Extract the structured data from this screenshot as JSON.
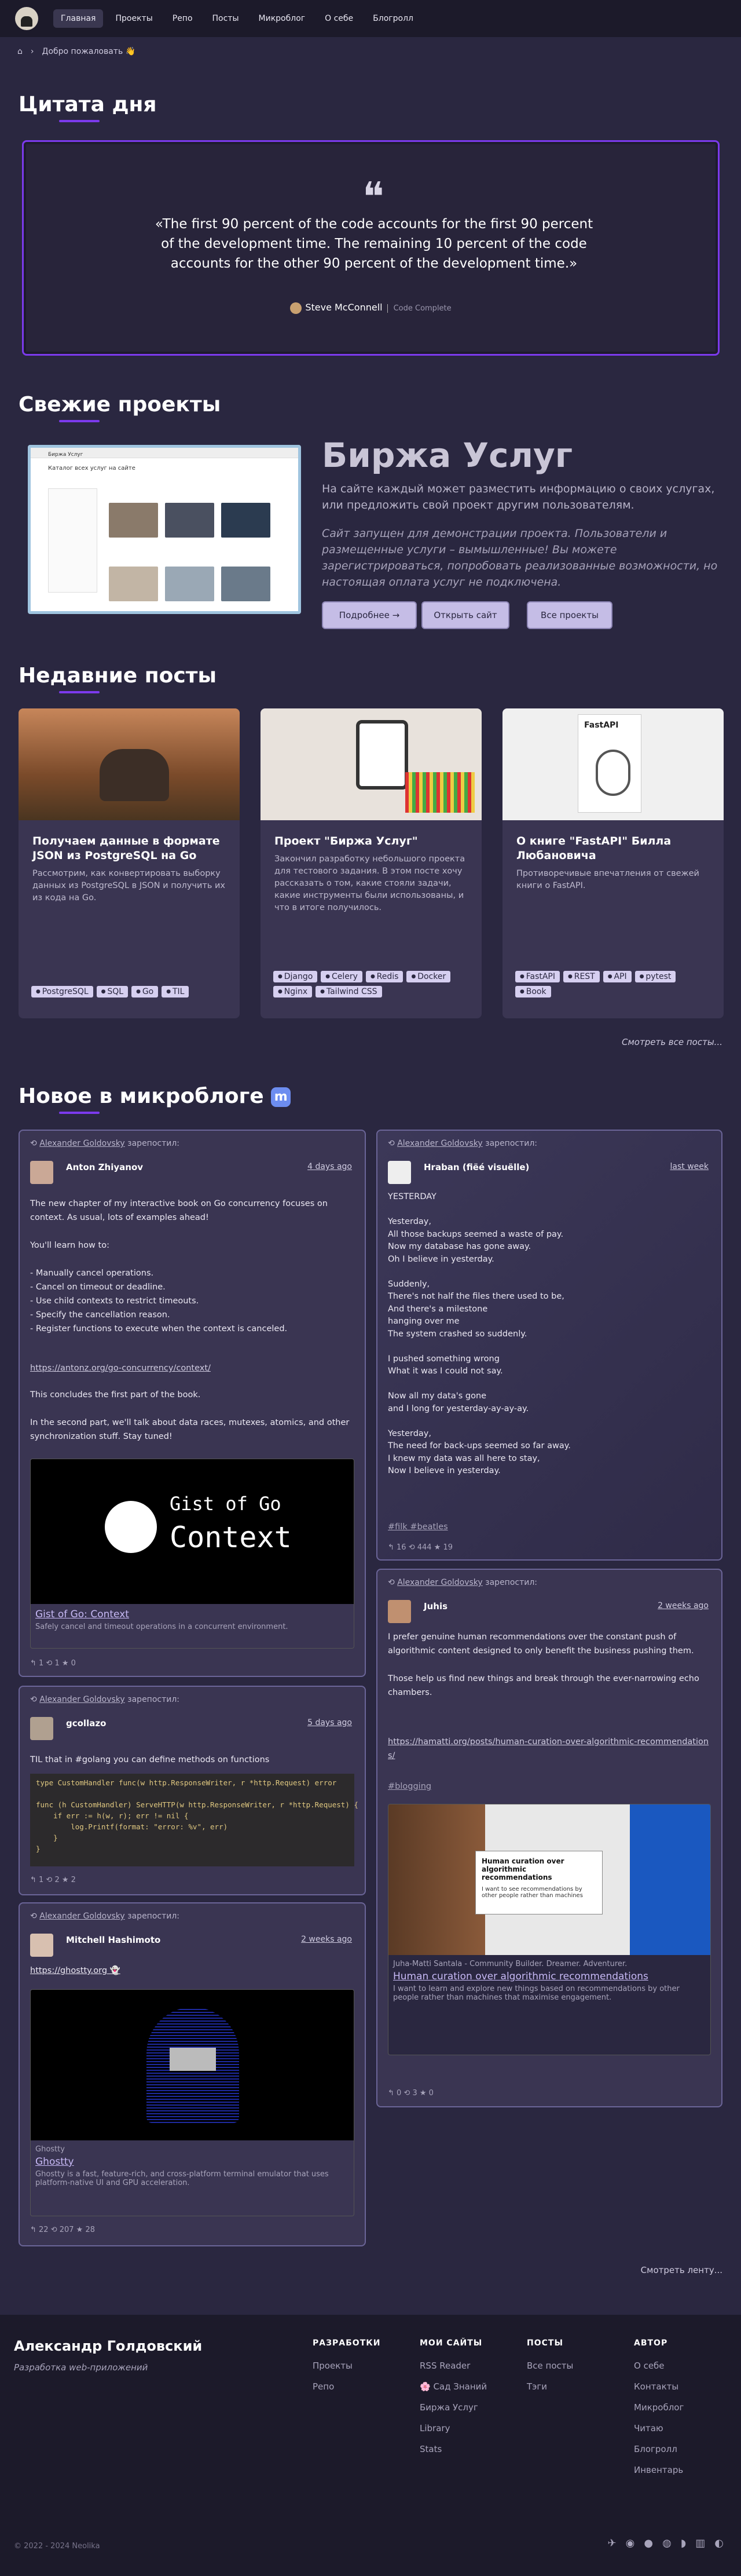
{
  "nav": {
    "items": [
      "Главная",
      "Проекты",
      "Репо",
      "Посты",
      "Микроблог",
      "О себе",
      "Блогролл"
    ]
  },
  "breadcrumb": {
    "welcome": "Добро пожаловать 👋"
  },
  "quote_section": {
    "title": "Цитата дня",
    "text": "«The first 90 percent of the code accounts for the first 90 percent of the development time. The remaining 10 percent of the code accounts for the other 90 percent of the development time.»",
    "author": "Steve McConnell",
    "source": "Code Complete"
  },
  "projects_section": {
    "title": "Свежие проекты",
    "project_title": "Биржа Услуг",
    "description": "На сайте каждый может разместить информацию о своих услугах, или предложить свой проект другим пользователям.",
    "note": "Сайт запущен для демонстрации проекта. Пользователи и размещенные услуги – вымышленные! Вы можете зарегистрироваться, попробовать реализованные возможности, но настоящая оплата услуг не подключена.",
    "btn_more": "Подробнее →",
    "btn_open": "Открыть сайт",
    "btn_all": "Все проекты",
    "screenshot_heading": "Биржа Услуг",
    "screenshot_sub": "Каталог всех услуг на сайте"
  },
  "posts_section": {
    "title": "Недавние посты",
    "more": "Смотреть все посты...",
    "cards": [
      {
        "title": "Получаем данные в формате JSON из PostgreSQL на Go",
        "desc": "Рассмотрим, как конвертировать выборку данных из PostgreSQL в JSON и получить их из кода на Go.",
        "tags": [
          "PostgreSQL",
          "SQL",
          "Go",
          "TIL"
        ]
      },
      {
        "title": "Проект \"Биржа Услуг\"",
        "desc": "Закончил разработку небольшого проекта для тестового задания. В этом посте хочу рассказать о том, какие стояли задачи, какие инструменты были использованы, и что в итоге получилось.",
        "tags": [
          "Django",
          "Celery",
          "Redis",
          "Docker",
          "Nginx",
          "Tailwind CSS"
        ]
      },
      {
        "title": "О книге \"FastAPI\" Билла Любановича",
        "desc": "Противоречивые впечатления от свежей книги о FastAPI.",
        "tags": [
          "FastAPI",
          "REST",
          "API",
          "pytest",
          "Book"
        ],
        "book_title": "FastAPI"
      }
    ]
  },
  "micro_section": {
    "title": "Новое в микроблоге",
    "more": "Смотреть ленту...",
    "reposted": "зарепостил:",
    "reposter": "Alexander Goldovsky",
    "posts": [
      {
        "name": "Anton Zhiyanov",
        "date": "4 days ago",
        "body": "The new chapter of my interactive book on Go concurrency focuses on context. As usual, lots of examples ahead!\n\nYou'll learn how to:\n\n- Manually cancel operations.\n- Cancel on timeout or deadline.\n- Use child contexts to restrict timeouts.\n- Specify the cancellation reason.\n- Register functions to execute when the context is canceled.",
        "link": "https://antonz.org/go-concurrency/context/",
        "body2": "This concludes the first part of the book.\n\nIn the second part, we'll talk about data races, mutexes, atomics, and other synchronization stuff. Stay tuned!",
        "preview_img_title": "Gist of Go",
        "preview_img_sub": "Context",
        "preview_title": "Gist of Go: Context",
        "preview_desc": "Safely cancel and timeout operations in a concurrent environment.",
        "stats": "↰ 1   ⟲ 1   ★ 0"
      },
      {
        "name": "gcollazo",
        "date": "5 days ago",
        "body": "TIL that in #golang you can define methods on functions",
        "code": "type CustomHandler func(w http.ResponseWriter, r *http.Request) error\n\nfunc (h CustomHandler) ServeHTTP(w http.ResponseWriter, r *http.Request) {\n    if err := h(w, r); err != nil {\n        log.Printf(format: \"error: %v\", err)\n    }\n}",
        "stats": "↰ 1   ⟲ 2   ★ 2"
      },
      {
        "name": "Mitchell Hashimoto",
        "date": "2 weeks ago",
        "body": "https://ghostty.org 👻",
        "preview_site": "Ghostty",
        "preview_title": "Ghostty",
        "preview_desc": "Ghostty is a fast, feature-rich, and cross-platform terminal emulator that uses platform-native UI and GPU acceleration.",
        "stats": "↰ 22   ⟲ 207   ★ 28"
      },
      {
        "name": "Hraban (fiëé visuëlle)",
        "date": "last week",
        "body": "YESTERDAY\n\nYesterday,\nAll those backups seemed a waste of pay.\nNow my database has gone away.\nOh I believe in yesterday.\n\nSuddenly,\nThere's not half the files there used to be,\nAnd there's a milestone\nhanging over me\nThe system crashed so suddenly.\n\nI pushed something wrong\nWhat it was I could not say.\n\nNow all my data's gone\nand I long for yesterday-ay-ay-ay.\n\nYesterday,\nThe need for back-ups seemed so far away.\nI knew my data was all here to stay,\nNow I believe in yesterday.",
        "hashtags": "#filk #beatles",
        "stats": "↰ 16   ⟲ 444   ★ 19"
      },
      {
        "name": "Juhis",
        "date": "2 weeks ago",
        "body": "I prefer genuine human recommendations over the constant push of algorithmic content designed to only benefit the business pushing them.\n\nThose help us find new things and break through the ever-narrowing echo chambers.",
        "link": "https://hamatti.org/posts/human-curation-over-algorithmic-recommendations/",
        "hashtags": "#blogging",
        "preview_img_text": "Human curation over algorithmic recommendations",
        "preview_img_sub": "I want to see recommendations by other people rather than machines",
        "preview_author": "Juha-Matti Santala - Community Builder. Dreamer. Adventurer.",
        "preview_title": "Human curation over algorithmic recommendations",
        "preview_desc": "I want to learn and explore new things based on recommendations by other people rather than machines that maximise engagement.",
        "stats": "↰ 0   ⟲ 3   ★ 0"
      }
    ]
  },
  "footer": {
    "name": "Александр Голдовский",
    "role": "Разработка web-приложений",
    "copyright": "© 2022 - 2024 Neolika",
    "cols": [
      {
        "title": "РАЗРАБОТКИ",
        "items": [
          "Проекты",
          "Репо"
        ]
      },
      {
        "title": "МОИ САЙТЫ",
        "items": [
          "RSS Reader",
          "🌸 Сад Знаний",
          "Биржа Услуг",
          "Library",
          "Stats"
        ]
      },
      {
        "title": "ПОСТЫ",
        "items": [
          "Все посты",
          "Тэги"
        ]
      },
      {
        "title": "АВТОР",
        "items": [
          "О себе",
          "Контакты",
          "Микроблог",
          "Читаю",
          "Блогролл",
          "Инвентарь"
        ]
      }
    ]
  },
  "colors": {
    "accent": "#7c3aed",
    "bg": "#2a2740",
    "card": "#3a3552"
  }
}
